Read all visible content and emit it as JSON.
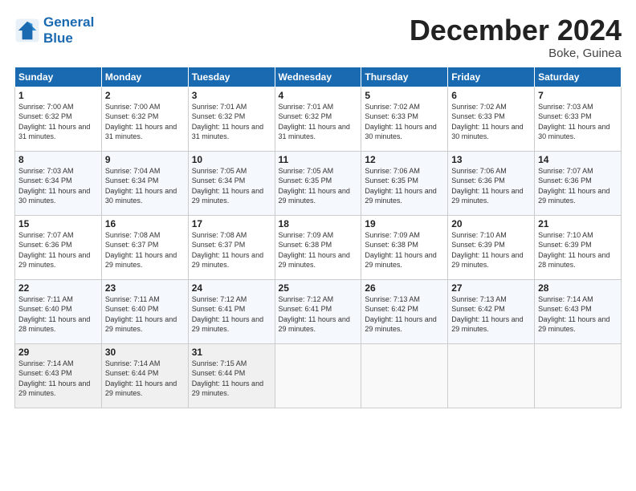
{
  "header": {
    "logo_line1": "General",
    "logo_line2": "Blue",
    "month_title": "December 2024",
    "location": "Boke, Guinea"
  },
  "days_of_week": [
    "Sunday",
    "Monday",
    "Tuesday",
    "Wednesday",
    "Thursday",
    "Friday",
    "Saturday"
  ],
  "weeks": [
    [
      {
        "day": "1",
        "sunrise": "7:00 AM",
        "sunset": "6:32 PM",
        "daylight": "11 hours and 31 minutes."
      },
      {
        "day": "2",
        "sunrise": "7:00 AM",
        "sunset": "6:32 PM",
        "daylight": "11 hours and 31 minutes."
      },
      {
        "day": "3",
        "sunrise": "7:01 AM",
        "sunset": "6:32 PM",
        "daylight": "11 hours and 31 minutes."
      },
      {
        "day": "4",
        "sunrise": "7:01 AM",
        "sunset": "6:32 PM",
        "daylight": "11 hours and 31 minutes."
      },
      {
        "day": "5",
        "sunrise": "7:02 AM",
        "sunset": "6:33 PM",
        "daylight": "11 hours and 30 minutes."
      },
      {
        "day": "6",
        "sunrise": "7:02 AM",
        "sunset": "6:33 PM",
        "daylight": "11 hours and 30 minutes."
      },
      {
        "day": "7",
        "sunrise": "7:03 AM",
        "sunset": "6:33 PM",
        "daylight": "11 hours and 30 minutes."
      }
    ],
    [
      {
        "day": "8",
        "sunrise": "7:03 AM",
        "sunset": "6:34 PM",
        "daylight": "11 hours and 30 minutes."
      },
      {
        "day": "9",
        "sunrise": "7:04 AM",
        "sunset": "6:34 PM",
        "daylight": "11 hours and 30 minutes."
      },
      {
        "day": "10",
        "sunrise": "7:05 AM",
        "sunset": "6:34 PM",
        "daylight": "11 hours and 29 minutes."
      },
      {
        "day": "11",
        "sunrise": "7:05 AM",
        "sunset": "6:35 PM",
        "daylight": "11 hours and 29 minutes."
      },
      {
        "day": "12",
        "sunrise": "7:06 AM",
        "sunset": "6:35 PM",
        "daylight": "11 hours and 29 minutes."
      },
      {
        "day": "13",
        "sunrise": "7:06 AM",
        "sunset": "6:36 PM",
        "daylight": "11 hours and 29 minutes."
      },
      {
        "day": "14",
        "sunrise": "7:07 AM",
        "sunset": "6:36 PM",
        "daylight": "11 hours and 29 minutes."
      }
    ],
    [
      {
        "day": "15",
        "sunrise": "7:07 AM",
        "sunset": "6:36 PM",
        "daylight": "11 hours and 29 minutes."
      },
      {
        "day": "16",
        "sunrise": "7:08 AM",
        "sunset": "6:37 PM",
        "daylight": "11 hours and 29 minutes."
      },
      {
        "day": "17",
        "sunrise": "7:08 AM",
        "sunset": "6:37 PM",
        "daylight": "11 hours and 29 minutes."
      },
      {
        "day": "18",
        "sunrise": "7:09 AM",
        "sunset": "6:38 PM",
        "daylight": "11 hours and 29 minutes."
      },
      {
        "day": "19",
        "sunrise": "7:09 AM",
        "sunset": "6:38 PM",
        "daylight": "11 hours and 29 minutes."
      },
      {
        "day": "20",
        "sunrise": "7:10 AM",
        "sunset": "6:39 PM",
        "daylight": "11 hours and 29 minutes."
      },
      {
        "day": "21",
        "sunrise": "7:10 AM",
        "sunset": "6:39 PM",
        "daylight": "11 hours and 28 minutes."
      }
    ],
    [
      {
        "day": "22",
        "sunrise": "7:11 AM",
        "sunset": "6:40 PM",
        "daylight": "11 hours and 28 minutes."
      },
      {
        "day": "23",
        "sunrise": "7:11 AM",
        "sunset": "6:40 PM",
        "daylight": "11 hours and 29 minutes."
      },
      {
        "day": "24",
        "sunrise": "7:12 AM",
        "sunset": "6:41 PM",
        "daylight": "11 hours and 29 minutes."
      },
      {
        "day": "25",
        "sunrise": "7:12 AM",
        "sunset": "6:41 PM",
        "daylight": "11 hours and 29 minutes."
      },
      {
        "day": "26",
        "sunrise": "7:13 AM",
        "sunset": "6:42 PM",
        "daylight": "11 hours and 29 minutes."
      },
      {
        "day": "27",
        "sunrise": "7:13 AM",
        "sunset": "6:42 PM",
        "daylight": "11 hours and 29 minutes."
      },
      {
        "day": "28",
        "sunrise": "7:14 AM",
        "sunset": "6:43 PM",
        "daylight": "11 hours and 29 minutes."
      }
    ],
    [
      {
        "day": "29",
        "sunrise": "7:14 AM",
        "sunset": "6:43 PM",
        "daylight": "11 hours and 29 minutes."
      },
      {
        "day": "30",
        "sunrise": "7:14 AM",
        "sunset": "6:44 PM",
        "daylight": "11 hours and 29 minutes."
      },
      {
        "day": "31",
        "sunrise": "7:15 AM",
        "sunset": "6:44 PM",
        "daylight": "11 hours and 29 minutes."
      },
      null,
      null,
      null,
      null
    ]
  ]
}
